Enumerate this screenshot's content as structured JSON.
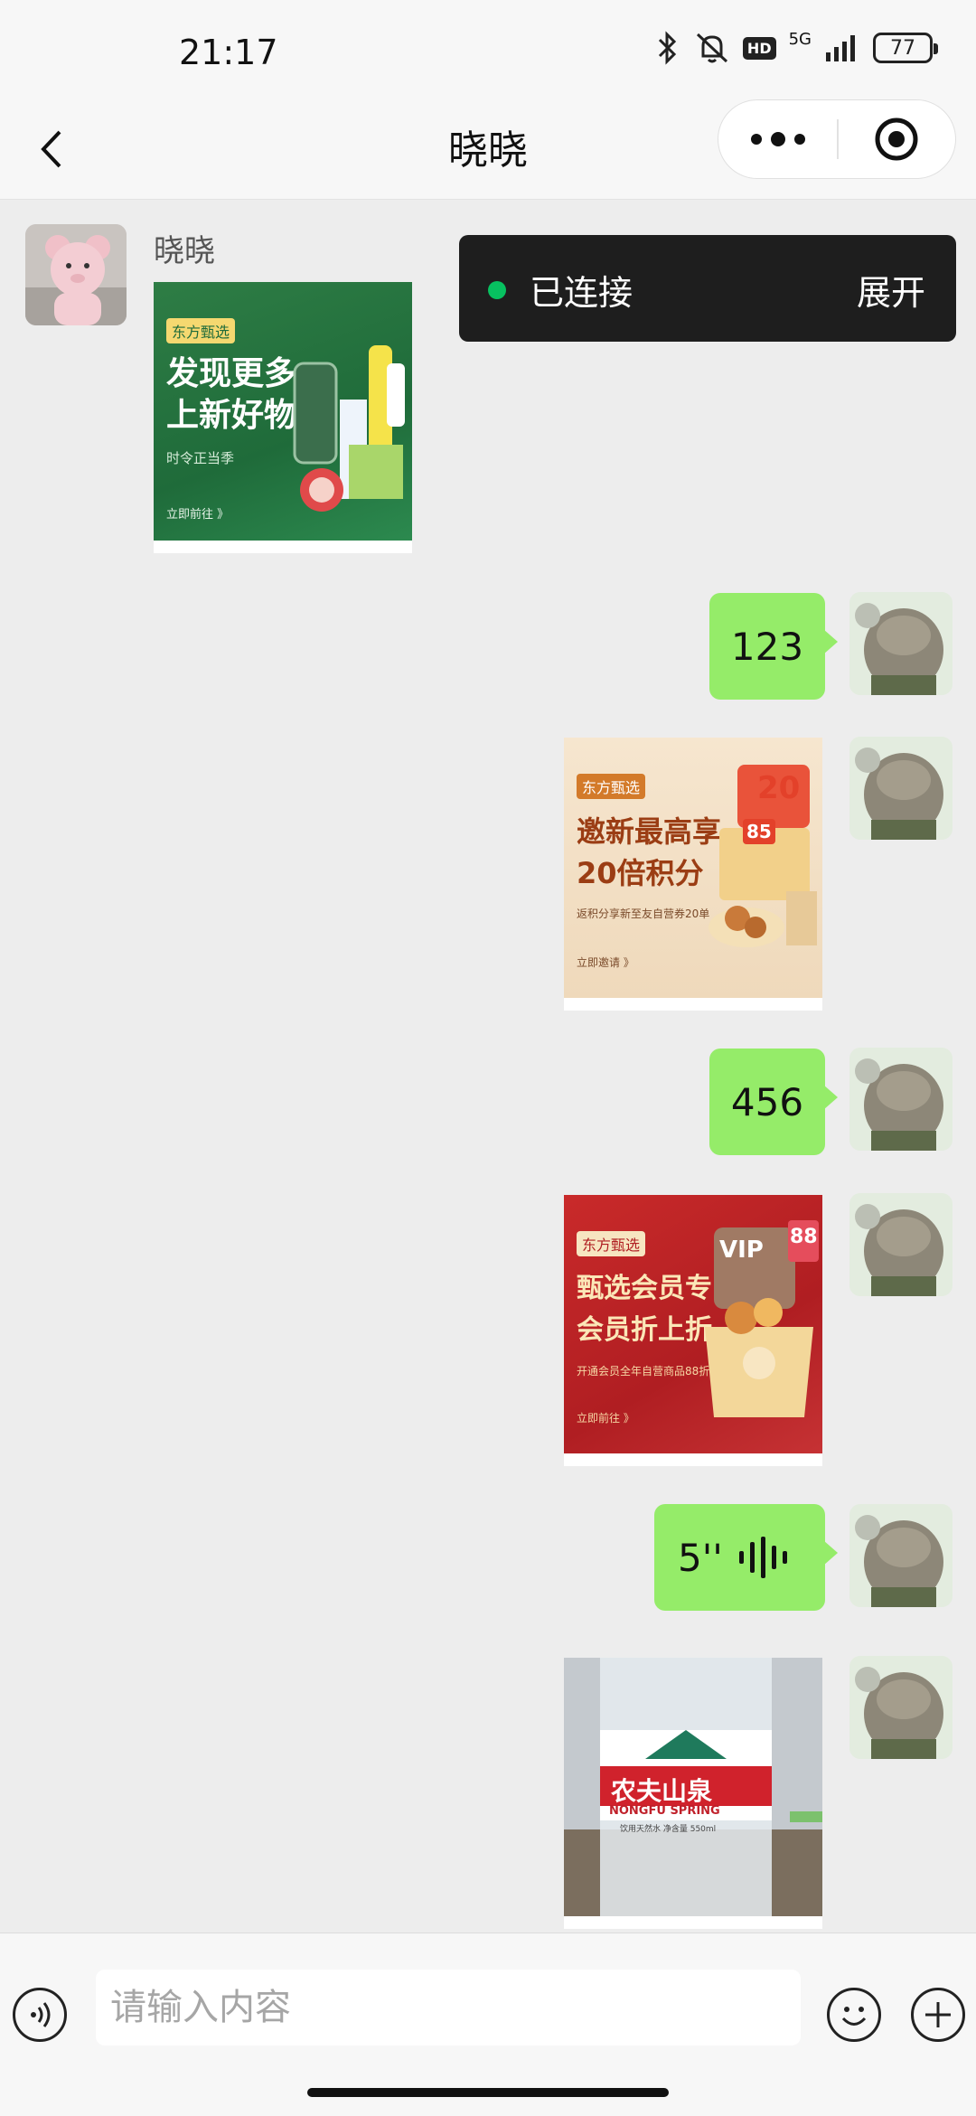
{
  "status_bar": {
    "time": "21:17",
    "network": "5G",
    "hd": "HD",
    "battery": "77"
  },
  "nav": {
    "title": "晓晓"
  },
  "connection": {
    "status": "已连接",
    "expand": "展开"
  },
  "chat": {
    "sender_name": "晓晓",
    "card1": {
      "tag": "东方甄选",
      "title_l1": "发现更多",
      "title_l2": "上新好物",
      "subtitle": "时令正当季",
      "cta": "立即前往 》"
    },
    "msg1": "123",
    "card2": {
      "tag": "东方甄选",
      "title_l1": "邀新最高享",
      "title_l2": "20倍积分",
      "subtitle": "返积分享新至友自营券20单",
      "cta": "立即邀请 》",
      "badge": "20",
      "badge2": "85"
    },
    "msg2": "456",
    "card3": {
      "tag": "东方甄选",
      "title_l1": "甄选会员专区",
      "title_l2": "会员折上折",
      "subtitle": "开通会员全年自营商品88折",
      "cta": "立即前往 》",
      "vip": "VIP",
      "badge": "88"
    },
    "voice": {
      "duration": "5''"
    },
    "photo": {
      "brand_cn": "农夫山泉",
      "brand_en": "NONGFU SPRING",
      "small": "饮用天然水 净含量 550ml"
    }
  },
  "input": {
    "placeholder": "请输入内容"
  },
  "icons": [
    "back-icon",
    "more-icon",
    "target-icon",
    "voice-icon",
    "emoji-icon",
    "plus-icon"
  ]
}
